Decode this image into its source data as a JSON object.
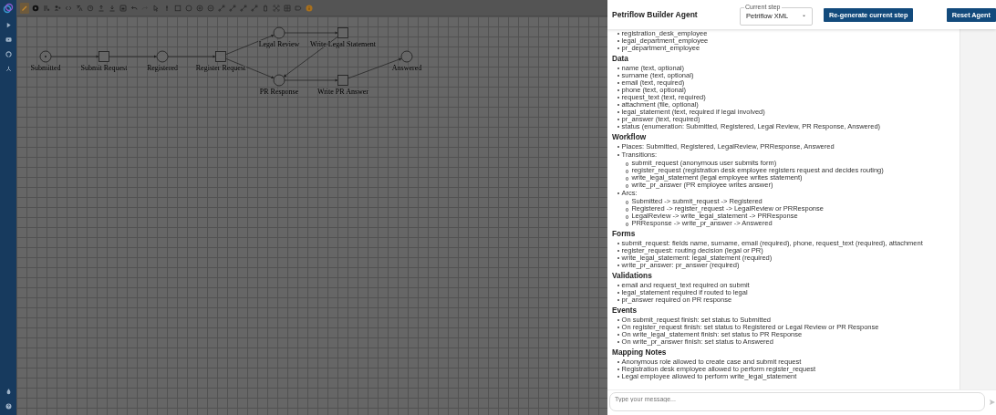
{
  "sidebar": {
    "items": [
      {
        "kind": "play"
      },
      {
        "kind": "video"
      },
      {
        "kind": "github"
      },
      {
        "kind": "network"
      }
    ],
    "bottom_items": [
      {
        "kind": "bug"
      },
      {
        "kind": "help"
      }
    ]
  },
  "toolbar": {
    "tools": [
      {
        "kind": "pencil",
        "selected": true
      },
      {
        "kind": "play",
        "selected": false
      },
      {
        "kind": "list-add",
        "selected": false
      },
      {
        "kind": "user-add",
        "selected": false
      },
      {
        "kind": "code",
        "selected": false
      },
      {
        "kind": "translate",
        "selected": false
      },
      {
        "kind": "history",
        "selected": false
      },
      {
        "kind": "upload",
        "selected": false
      },
      {
        "kind": "download",
        "selected": false
      },
      {
        "kind": "save",
        "selected": false
      },
      {
        "kind": "undo",
        "selected": false
      },
      {
        "kind": "redo",
        "selected": false
      },
      {
        "kind": "cursor",
        "selected": false
      },
      {
        "kind": "marker",
        "selected": false
      },
      {
        "kind": "square",
        "selected": false
      },
      {
        "kind": "circle",
        "selected": false
      },
      {
        "kind": "plus-circle",
        "selected": false
      },
      {
        "kind": "minus-circle",
        "selected": false
      },
      {
        "kind": "arc",
        "selected": false
      },
      {
        "kind": "arc",
        "selected": false
      },
      {
        "kind": "arc",
        "selected": false
      },
      {
        "kind": "arc",
        "selected": false
      },
      {
        "kind": "delete",
        "selected": false
      },
      {
        "kind": "fit",
        "selected": false
      },
      {
        "kind": "grid",
        "selected": false
      },
      {
        "kind": "label",
        "selected": false
      },
      {
        "kind": "info",
        "selected": false
      }
    ]
  },
  "net": {
    "nodes": [
      {
        "kind": "place",
        "label": "Submitted",
        "token": true
      },
      {
        "kind": "transition",
        "label": "Submit Request"
      },
      {
        "kind": "place",
        "label": "Registered",
        "token": false
      },
      {
        "kind": "transition",
        "label": "Register Request"
      },
      {
        "kind": "place",
        "label": "Legal Review",
        "token": false
      },
      {
        "kind": "transition",
        "label": "Write Legal Statement"
      },
      {
        "kind": "place",
        "label": "PR Response",
        "token": false
      },
      {
        "kind": "transition",
        "label": "Write PR Answer"
      },
      {
        "kind": "place",
        "label": "Answered",
        "token": false
      }
    ]
  },
  "agent": {
    "title": "Petriflow Builder Agent",
    "step": {
      "label": "Current step",
      "value": "Petriflow XML"
    },
    "regenerate_button": "Re-generate current step",
    "reset_button": "Reset Agent",
    "content": [
      {
        "kind": "list",
        "items": [
          {
            "text": "registration_desk_employee"
          },
          {
            "text": "legal_department_employee"
          },
          {
            "text": "pr_department_employee"
          }
        ]
      },
      {
        "kind": "heading",
        "text": "Data"
      },
      {
        "kind": "list",
        "items": [
          {
            "text": "name (text, optional)"
          },
          {
            "text": "surname (text, optional)"
          },
          {
            "text": "email (text, required)"
          },
          {
            "text": "phone (text, optional)"
          },
          {
            "text": "request_text (text, required)"
          },
          {
            "text": "attachment (file, optional)"
          },
          {
            "text": "legal_statement (text, required if legal involved)"
          },
          {
            "text": "pr_answer (text, required)"
          },
          {
            "text": "status (enumeration: Submitted, Registered, Legal Review, PR Response, Answered)"
          }
        ]
      },
      {
        "kind": "heading",
        "text": "Workflow"
      },
      {
        "kind": "list",
        "items": [
          {
            "text": "Places: Submitted, Registered, LegalReview, PRResponse, Answered"
          },
          {
            "text": "Transitions:",
            "children": [
              {
                "text": "submit_request (anonymous user submits form)"
              },
              {
                "text": "register_request (registration desk employee registers request and decides routing)"
              },
              {
                "text": "write_legal_statement (legal employee writes statement)"
              },
              {
                "text": "write_pr_answer (PR employee writes answer)"
              }
            ]
          },
          {
            "text": "Arcs:",
            "children": [
              {
                "text": "Submitted -> submit_request -> Registered"
              },
              {
                "text": "Registered -> register_request -> LegalReview or PRResponse"
              },
              {
                "text": "LegalReview -> write_legal_statement -> PRResponse"
              },
              {
                "text": "PRResponse -> write_pr_answer -> Answered"
              }
            ]
          }
        ]
      },
      {
        "kind": "heading",
        "text": "Forms"
      },
      {
        "kind": "list",
        "items": [
          {
            "text": "submit_request: fields name, surname, email (required), phone, request_text (required), attachment"
          },
          {
            "text": "register_request: routing decision (legal or PR)"
          },
          {
            "text": "write_legal_statement: legal_statement (required)"
          },
          {
            "text": "write_pr_answer: pr_answer (required)"
          }
        ]
      },
      {
        "kind": "heading",
        "text": "Validations"
      },
      {
        "kind": "list",
        "items": [
          {
            "text": "email and request_text required on submit"
          },
          {
            "text": "legal_statement required if routed to legal"
          },
          {
            "text": "pr_answer required on PR response"
          }
        ]
      },
      {
        "kind": "heading",
        "text": "Events"
      },
      {
        "kind": "list",
        "items": [
          {
            "text": "On submit_request finish: set status to Submitted"
          },
          {
            "text": "On register_request finish: set status to Registered or Legal Review or PR Response"
          },
          {
            "text": "On write_legal_statement finish: set status to PR Response"
          },
          {
            "text": "On write_pr_answer finish: set status to Answered"
          }
        ]
      },
      {
        "kind": "heading",
        "text": "Mapping Notes"
      },
      {
        "kind": "list",
        "items": [
          {
            "text": "Anonymous role allowed to create case and submit request"
          },
          {
            "text": "Registration desk employee allowed to perform register_request"
          },
          {
            "text": "Legal employee allowed to perform write_legal_statement"
          }
        ]
      }
    ],
    "message": {
      "placeholder": "Type your message..."
    }
  }
}
